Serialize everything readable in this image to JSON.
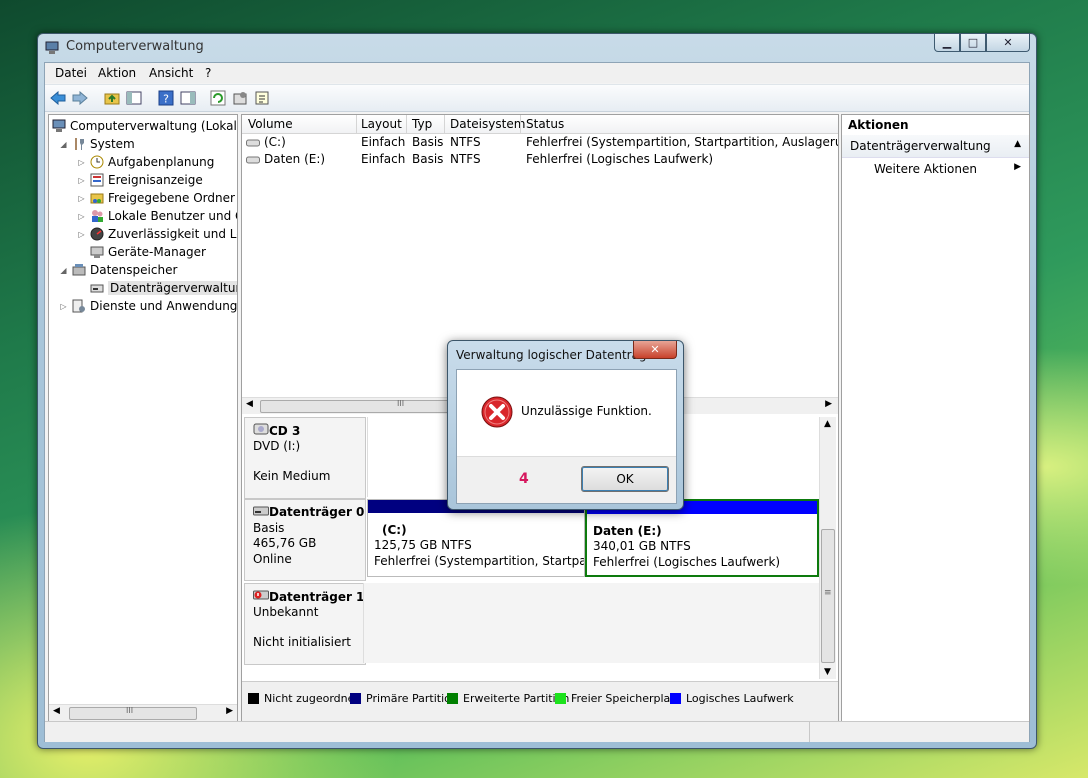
{
  "window": {
    "title": "Computerverwaltung",
    "min_glyph": "▁",
    "max_glyph": "□",
    "close_glyph": "✕"
  },
  "menu": [
    "Datei",
    "Aktion",
    "Ansicht",
    "?"
  ],
  "tree": {
    "root": "Computerverwaltung (Lokal)",
    "system": "System",
    "aufgabenplanung": "Aufgabenplanung",
    "ereignisanzeige": "Ereignisanzeige",
    "freigegebene": "Freigegebene Ordner",
    "lokale": "Lokale Benutzer und Gr",
    "zuverlaessigkeit": "Zuverlässigkeit und Leis",
    "geraete": "Geräte-Manager",
    "datenspeicher": "Datenspeicher",
    "datentraeger": "Datenträgerverwaltung",
    "dienste": "Dienste und Anwendungen"
  },
  "volumes": {
    "headers": [
      "Volume",
      "Layout",
      "Typ",
      "Dateisystem",
      "Status"
    ],
    "rows": [
      [
        "(C:)",
        "Einfach",
        "Basis",
        "NTFS",
        "Fehlerfrei (Systempartition, Startpartition, Auslagerungsdatei"
      ],
      [
        "Daten (E:)",
        "Einfach",
        "Basis",
        "NTFS",
        "Fehlerfrei (Logisches Laufwerk)"
      ]
    ]
  },
  "disks": {
    "cd": {
      "name": "CD 3",
      "type": "DVD (I:)",
      "state": "Kein Medium"
    },
    "disk0": {
      "name": "Datenträger 0",
      "type": "Basis",
      "size": "465,76 GB",
      "state": "Online",
      "c": {
        "label": "(C:)",
        "size": "125,75 GB NTFS",
        "status": "Fehlerfrei (Systempartition, Startpartiti"
      },
      "e": {
        "label": "Daten  (E:)",
        "size": "340,01 GB NTFS",
        "status": "Fehlerfrei (Logisches Laufwerk)"
      }
    },
    "disk1": {
      "name": "Datenträger 1",
      "type": "Unbekannt",
      "state": "Nicht initialisiert"
    }
  },
  "legend": [
    "Nicht zugeordnet",
    "Primäre Partition",
    "Erweiterte Partition",
    "Freier Speicherplatz",
    "Logisches Laufwerk"
  ],
  "colors": {
    "unallocated": "#000000",
    "primary": "#000080",
    "extended": "#008000",
    "free": "#1de21d",
    "logical": "#0000ff",
    "error": "#d9262b",
    "annotation": "#d6185e"
  },
  "actions": {
    "header": "Aktionen",
    "section": "Datenträgerverwaltung",
    "more": "Weitere Aktionen"
  },
  "dialog": {
    "title": "Verwaltung logischer Datenträg...",
    "message": "Unzulässige Funktion.",
    "ok": "OK",
    "annotation": "4",
    "close_glyph": "✕"
  },
  "scroll": {
    "track_glyph": "III",
    "vtrack_glyph": "≡"
  }
}
